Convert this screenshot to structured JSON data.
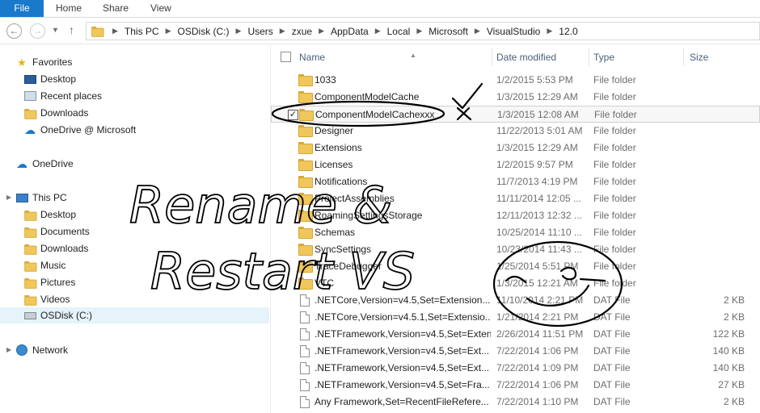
{
  "ribbon": {
    "file": "File",
    "home": "Home",
    "share": "Share",
    "view": "View"
  },
  "address": {
    "crumbs": [
      "This PC",
      "OSDisk (C:)",
      "Users",
      "zxue",
      "AppData",
      "Local",
      "Microsoft",
      "VisualStudio",
      "12.0"
    ]
  },
  "nav": {
    "favorites": "Favorites",
    "desktop": "Desktop",
    "recent_places": "Recent places",
    "downloads": "Downloads",
    "onedrive_ms": "OneDrive @ Microsoft",
    "onedrive": "OneDrive",
    "this_pc": "This PC",
    "pc_desktop": "Desktop",
    "documents": "Documents",
    "pc_downloads": "Downloads",
    "music": "Music",
    "pictures": "Pictures",
    "videos": "Videos",
    "osdisk": "OSDisk (C:)",
    "network": "Network"
  },
  "columns": {
    "name": "Name",
    "date": "Date modified",
    "type": "Type",
    "size": "Size"
  },
  "files": [
    {
      "name": "1033",
      "date": "1/2/2015 5:53 PM",
      "type": "File folder",
      "size": "",
      "kind": "folder"
    },
    {
      "name": "ComponentModelCache",
      "date": "1/3/2015 12:29 AM",
      "type": "File folder",
      "size": "",
      "kind": "folder"
    },
    {
      "name": "ComponentModelCachexxx",
      "date": "1/3/2015 12:08 AM",
      "type": "File folder",
      "size": "",
      "kind": "folder",
      "checked": true
    },
    {
      "name": "Designer",
      "date": "11/22/2013 5:01 AM",
      "type": "File folder",
      "size": "",
      "kind": "folder"
    },
    {
      "name": "Extensions",
      "date": "1/3/2015 12:29 AM",
      "type": "File folder",
      "size": "",
      "kind": "folder"
    },
    {
      "name": "Licenses",
      "date": "1/2/2015 9:57 PM",
      "type": "File folder",
      "size": "",
      "kind": "folder"
    },
    {
      "name": "Notifications",
      "date": "11/7/2013 4:19 PM",
      "type": "File folder",
      "size": "",
      "kind": "folder"
    },
    {
      "name": "ProjectAssemblies",
      "date": "11/11/2014 12:05 ...",
      "type": "File folder",
      "size": "",
      "kind": "folder"
    },
    {
      "name": "RoamingSettingsStorage",
      "date": "12/11/2013 12:32 ...",
      "type": "File folder",
      "size": "",
      "kind": "folder"
    },
    {
      "name": "Schemas",
      "date": "10/25/2014 11:10 ...",
      "type": "File folder",
      "size": "",
      "kind": "folder"
    },
    {
      "name": "SyncSettings",
      "date": "10/23/2014 11:43 ...",
      "type": "File folder",
      "size": "",
      "kind": "folder"
    },
    {
      "name": "TraceDebugger",
      "date": "1/25/2014 5:51 PM",
      "type": "File folder",
      "size": "",
      "kind": "folder"
    },
    {
      "name": "VTC",
      "date": "1/3/2015 12:21 AM",
      "type": "File folder",
      "size": "",
      "kind": "folder"
    },
    {
      "name": ".NETCore,Version=v4.5,Set=Extension...",
      "date": "11/10/2014 2:21 PM",
      "type": "DAT File",
      "size": "2 KB",
      "kind": "file"
    },
    {
      "name": ".NETCore,Version=v4.5.1,Set=Extensio...",
      "date": "1/21/2014 2:21 PM",
      "type": "DAT File",
      "size": "2 KB",
      "kind": "file"
    },
    {
      "name": ".NETFramework,Version=v4.5,Set=Extension...",
      "date": "2/26/2014 11:51 PM",
      "type": "DAT File",
      "size": "122 KB",
      "kind": "file"
    },
    {
      "name": ".NETFramework,Version=v4.5,Set=Ext...",
      "date": "7/22/2014 1:06 PM",
      "type": "DAT File",
      "size": "140 KB",
      "kind": "file"
    },
    {
      "name": ".NETFramework,Version=v4.5,Set=Ext...",
      "date": "7/22/2014 1:09 PM",
      "type": "DAT File",
      "size": "140 KB",
      "kind": "file"
    },
    {
      "name": ".NETFramework,Version=v4.5,Set=Fra...",
      "date": "7/22/2014 1:06 PM",
      "type": "DAT File",
      "size": "27 KB",
      "kind": "file"
    },
    {
      "name": "Any Framework,Set=RecentFileRefere...",
      "date": "7/22/2014 1:10 PM",
      "type": "DAT File",
      "size": "2 KB",
      "kind": "file"
    }
  ],
  "annotation": {
    "line1": "Rename &",
    "line2": "Restart VS"
  }
}
